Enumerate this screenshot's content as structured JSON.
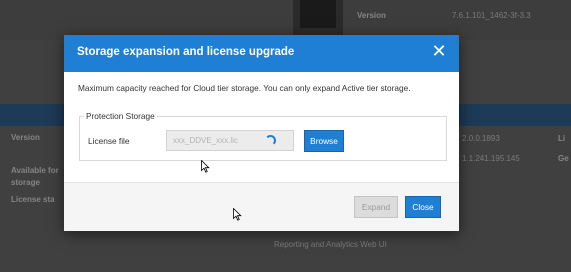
{
  "background": {
    "version_label_top": "Version",
    "version_value_top": "7.6.1.101_1462-3f-3.3",
    "version_label_left": "Version",
    "available_line1": "Available for",
    "available_line2": "storage",
    "license_label": "License sta",
    "right_value_1": "2.0.0.1893",
    "right_value_2": "1.1.241.195.145",
    "right_label_1": "Li",
    "right_label_2": "Ge",
    "link_text": "Reporting and Analytics Web UI"
  },
  "modal": {
    "title": "Storage expansion and license upgrade",
    "message": "Maximum capacity reached for Cloud tier storage. You can only expand Active tier storage.",
    "section_legend": "Protection Storage",
    "license_file_label": "License file",
    "license_file_placeholder": "xxx_DDVE_xxx.lic",
    "browse_label": "Browse",
    "expand_label": "Expand",
    "close_label": "Close"
  },
  "colors": {
    "accent": "#1f7fd4",
    "overlay": "#404040",
    "disabled": "#dcdcdc"
  }
}
